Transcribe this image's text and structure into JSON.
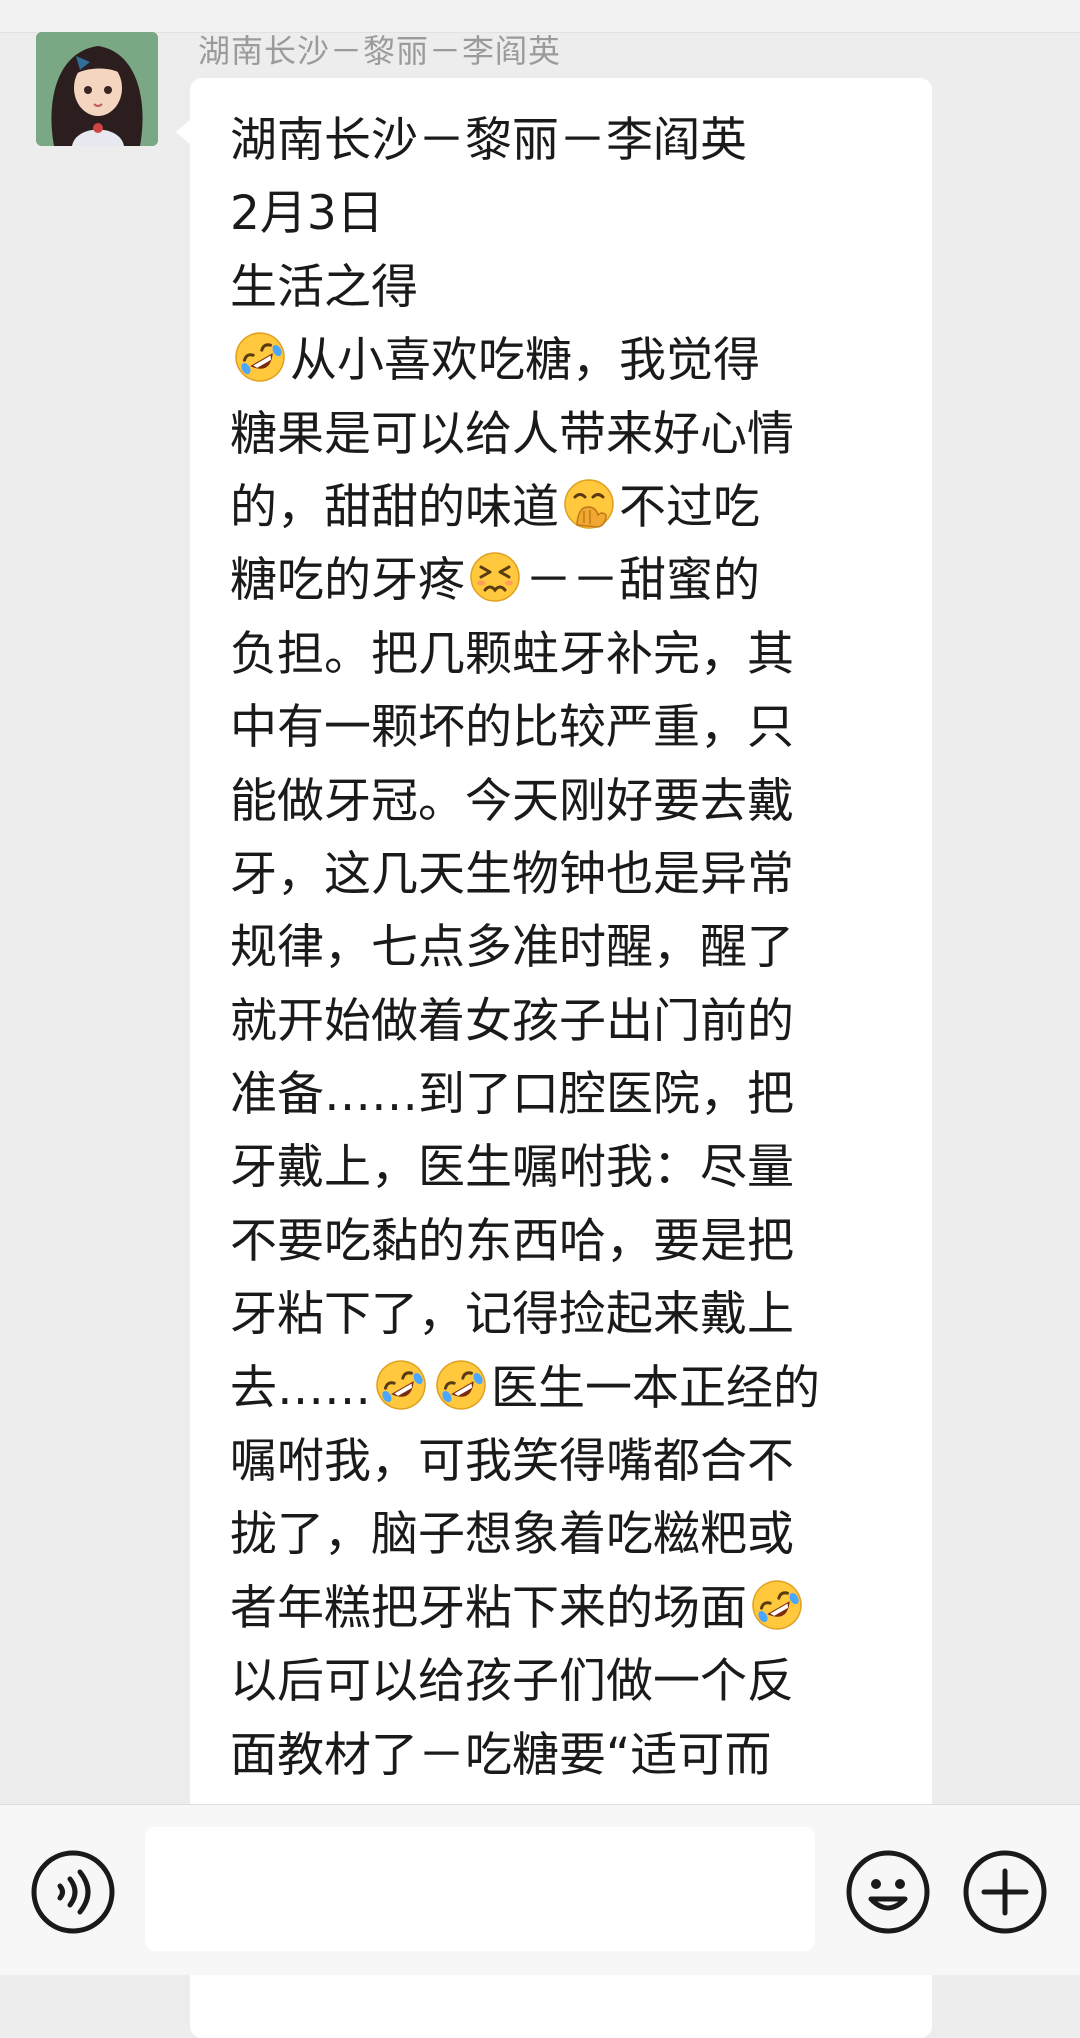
{
  "chat": {
    "sender_name": "湖南长沙－黎丽－李阎英",
    "message_segments": [
      [
        "湖南长沙－黎丽－李阎英"
      ],
      [
        "2月3日"
      ],
      [
        "生活之得"
      ],
      [
        {
          "emoji": "rofl-emoji"
        },
        "从小喜欢吃糖，我觉得"
      ],
      [
        "糖果是可以给人带来好心情"
      ],
      [
        "的，甜甜的味道",
        {
          "emoji": "hand-over-mouth-emoji"
        },
        "不过吃"
      ],
      [
        "糖吃的牙疼",
        {
          "emoji": "persevering-face-emoji"
        },
        "－－甜蜜的"
      ],
      [
        "负担。把几颗蛀牙补完，其"
      ],
      [
        "中有一颗坏的比较严重，只"
      ],
      [
        "能做牙冠。今天刚好要去戴"
      ],
      [
        "牙，这几天生物钟也是异常"
      ],
      [
        "规律，七点多准时醒，醒了"
      ],
      [
        "就开始做着女孩子出门前的"
      ],
      [
        "准备……到了口腔医院，把"
      ],
      [
        "牙戴上，医生嘱咐我：尽量"
      ],
      [
        "不要吃黏的东西哈，要是把"
      ],
      [
        "牙粘下了，记得捡起来戴上"
      ],
      [
        "去……",
        {
          "emoji": "rofl-emoji"
        },
        {
          "emoji": "rofl-emoji"
        },
        "医生一本正经的"
      ],
      [
        "嘱咐我，可我笑得嘴都合不"
      ],
      [
        "拢了，脑子想象着吃糍粑或"
      ],
      [
        "者年糕把牙粘下来的场面",
        {
          "emoji": "rofl-emoji"
        }
      ],
      [
        "以后可以给孩子们做一个反"
      ],
      [
        "面教材了－吃糖要“适可而"
      ]
    ]
  },
  "input_bar": {
    "text_value": "",
    "voice_icon": "voice-icon",
    "emoji_icon": "emoji-face-icon",
    "plus_icon": "plus-icon"
  },
  "colors": {
    "background": "#ededed",
    "bubble": "#ffffff",
    "sender_name": "#9b9b9b",
    "message_text": "#1a1a1a"
  }
}
